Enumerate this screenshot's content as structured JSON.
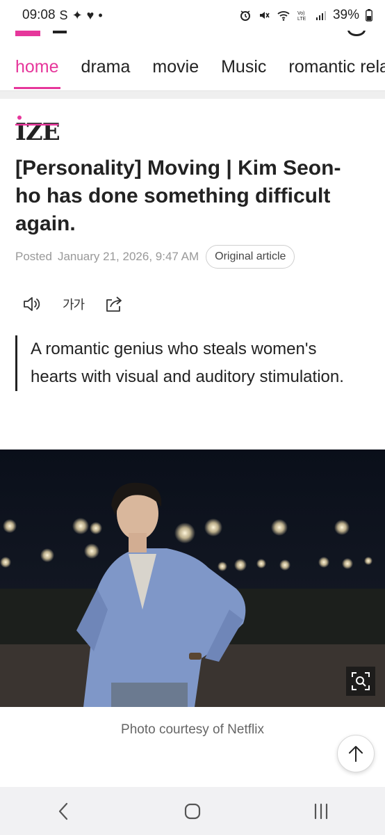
{
  "status_bar": {
    "time": "09:08",
    "left_glyphs": [
      "S",
      "✦",
      "♥",
      "•"
    ],
    "battery": "39%",
    "icons": [
      "alarm-icon",
      "mute-icon",
      "wifi-icon",
      "volte-icon",
      "signal-icon",
      "battery-icon"
    ]
  },
  "nav": {
    "tabs": [
      {
        "label": "home",
        "active": true
      },
      {
        "label": "drama",
        "active": false
      },
      {
        "label": "movie",
        "active": false
      },
      {
        "label": "Music",
        "active": false
      },
      {
        "label": "romantic rela",
        "active": false
      }
    ]
  },
  "article": {
    "brand": "IZE",
    "title": "[Personality] Moving | Kim Seon-ho has done something difficult again.",
    "posted_label": "Posted",
    "date": "January 21, 2026, 9:47 AM",
    "original_button": "Original article",
    "font_size_label": "가가",
    "summary": "A romantic genius who steals women's hearts with visual and auditory stimulation.",
    "caption": "Photo courtesy of Netflix"
  },
  "colors": {
    "accent": "#e6379b",
    "text": "#222222",
    "muted": "#999999",
    "nav_bar_bg": "#f1f1f3"
  }
}
